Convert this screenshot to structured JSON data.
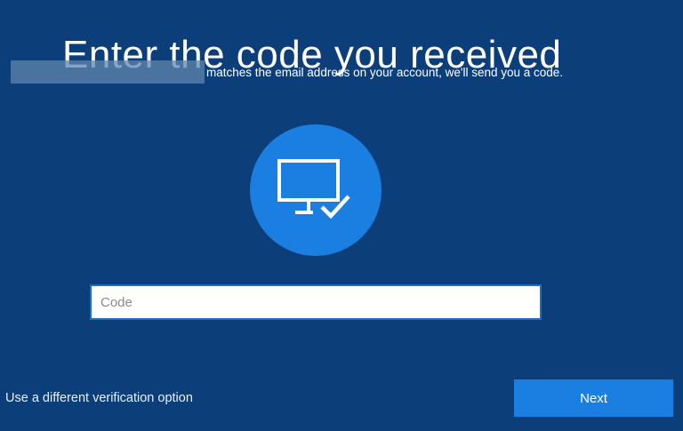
{
  "header": {
    "title": "Enter the code you received",
    "subtitle": "matches the email address on your account, we'll send you a code."
  },
  "illustration": {
    "icon": "monitor-check-icon",
    "circle_color": "#1a7fe0"
  },
  "code_field": {
    "placeholder": "Code",
    "value": ""
  },
  "footer": {
    "alternate_option_label": "Use a different verification option",
    "next_label": "Next"
  },
  "colors": {
    "background": "#0c3f7a",
    "accent": "#1a7fe0"
  }
}
